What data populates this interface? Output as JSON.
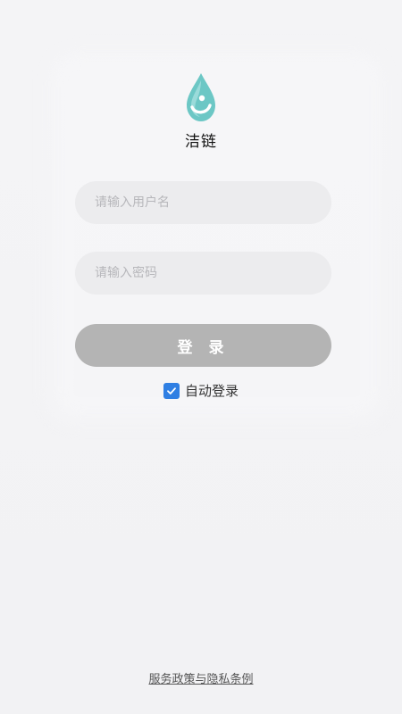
{
  "app": {
    "name": "洁链"
  },
  "form": {
    "username_placeholder": "请输入用户名",
    "password_placeholder": "请输入密码",
    "login_label": "登 录",
    "auto_login_label": "自动登录",
    "auto_login_checked": true
  },
  "footer": {
    "policy_link": "服务政策与隐私条例"
  },
  "icons": {
    "logo": "water-drop-logo-icon",
    "checkbox": "checkmark-icon"
  },
  "colors": {
    "logo_teal": "#6cc7c5",
    "button_disabled": "#b4b4b4",
    "checkbox_accent": "#2f7fe3",
    "field_bg": "#ececee"
  }
}
